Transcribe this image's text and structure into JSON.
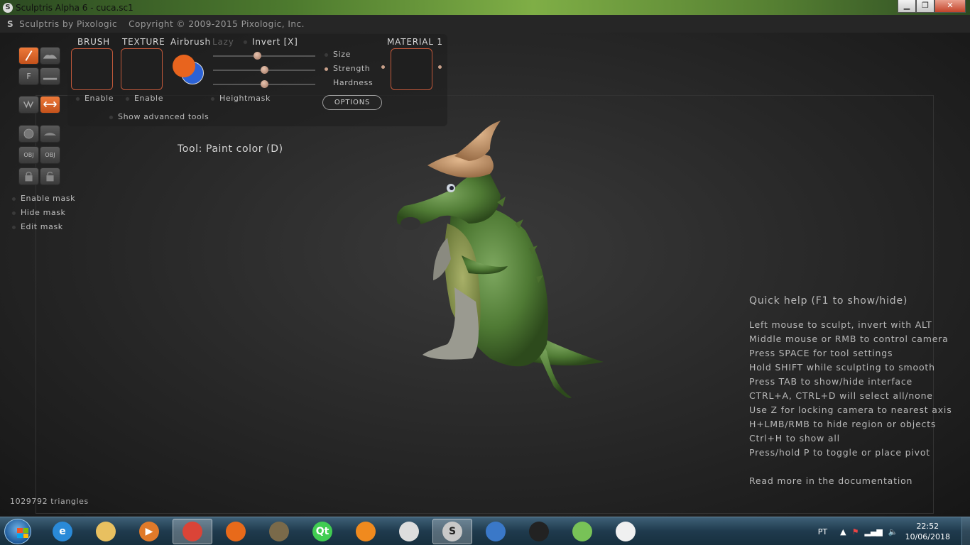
{
  "window": {
    "title": "Sculptris Alpha 6 - cuca.sc1",
    "minimize_label": "▁",
    "maximize_label": "❐",
    "close_label": "✕"
  },
  "menu": {
    "app_name": "Sculptris by Pixologic",
    "copyright": "Copyright © 2009-2015 Pixologic, Inc."
  },
  "panel": {
    "brush_label": "BRUSH",
    "texture_label": "TEXTURE",
    "airbrush_label": "Airbrush",
    "lazy_label": "Lazy",
    "invert_label": "Invert [X]",
    "material_label": "MATERIAL 1",
    "brush_enable": "Enable",
    "texture_enable": "Enable",
    "heightmask_label": "Heightmask",
    "show_advanced": "Show advanced tools",
    "size_label": "Size",
    "strength_label": "Strength",
    "hardness_label": "Hardness",
    "options_label": "OPTIONS",
    "size_value": 0.43,
    "strength_value": 0.5,
    "hardness_value": 0.5,
    "primary_color": "#e8641e",
    "secondary_color": "#2b62d6"
  },
  "tools": {
    "f_label": "F",
    "obj1_label": "OBJ",
    "obj2_label": "OBJ"
  },
  "mask": {
    "enable": "Enable mask",
    "hide": "Hide mask",
    "edit": "Edit mask"
  },
  "viewport": {
    "tool_status": "Tool: Paint color (D)",
    "triangles": "1029792 triangles"
  },
  "quick_help": {
    "title": "Quick help (F1 to show/hide)",
    "lines": [
      "Left mouse to sculpt, invert with ALT",
      "Middle mouse or RMB to control camera",
      "Press SPACE for tool settings",
      "Hold SHIFT while sculpting to smooth",
      "Press TAB to show/hide interface",
      "CTRL+A, CTRL+D will select all/none",
      "Use Z for locking camera to nearest axis",
      "H+LMB/RMB to hide region or objects",
      "Ctrl+H to show all",
      "Press/hold P to toggle or place pivot"
    ],
    "more": "Read more in the documentation"
  },
  "taskbar": {
    "language": "PT",
    "time": "22:52",
    "date": "10/06/2018",
    "items": [
      {
        "name": "internet-explorer-icon",
        "glyph": "e",
        "color": "#2a8ad8"
      },
      {
        "name": "file-explorer-icon",
        "glyph": "",
        "color": "#e8c060"
      },
      {
        "name": "media-player-icon",
        "glyph": "▶",
        "color": "#e07a2a"
      },
      {
        "name": "chrome-icon",
        "glyph": "",
        "color": "#db4437"
      },
      {
        "name": "firefox-icon",
        "glyph": "",
        "color": "#e86a1a"
      },
      {
        "name": "gimp-icon",
        "glyph": "",
        "color": "#7a6a4a"
      },
      {
        "name": "qt-creator-icon",
        "glyph": "Qt",
        "color": "#41cd52"
      },
      {
        "name": "blender-icon",
        "glyph": "",
        "color": "#f08a1e"
      },
      {
        "name": "unity-icon",
        "glyph": "",
        "color": "#dddddd"
      },
      {
        "name": "sculptris-icon",
        "glyph": "S",
        "color": "#c8c8c8"
      },
      {
        "name": "bitmap-app-icon",
        "glyph": "",
        "color": "#3a78c8"
      },
      {
        "name": "inkscape-icon",
        "glyph": "",
        "color": "#222222"
      },
      {
        "name": "android-studio-icon",
        "glyph": "",
        "color": "#78c257"
      },
      {
        "name": "zbrush-icon",
        "glyph": "",
        "color": "#f0f0f0"
      }
    ]
  }
}
